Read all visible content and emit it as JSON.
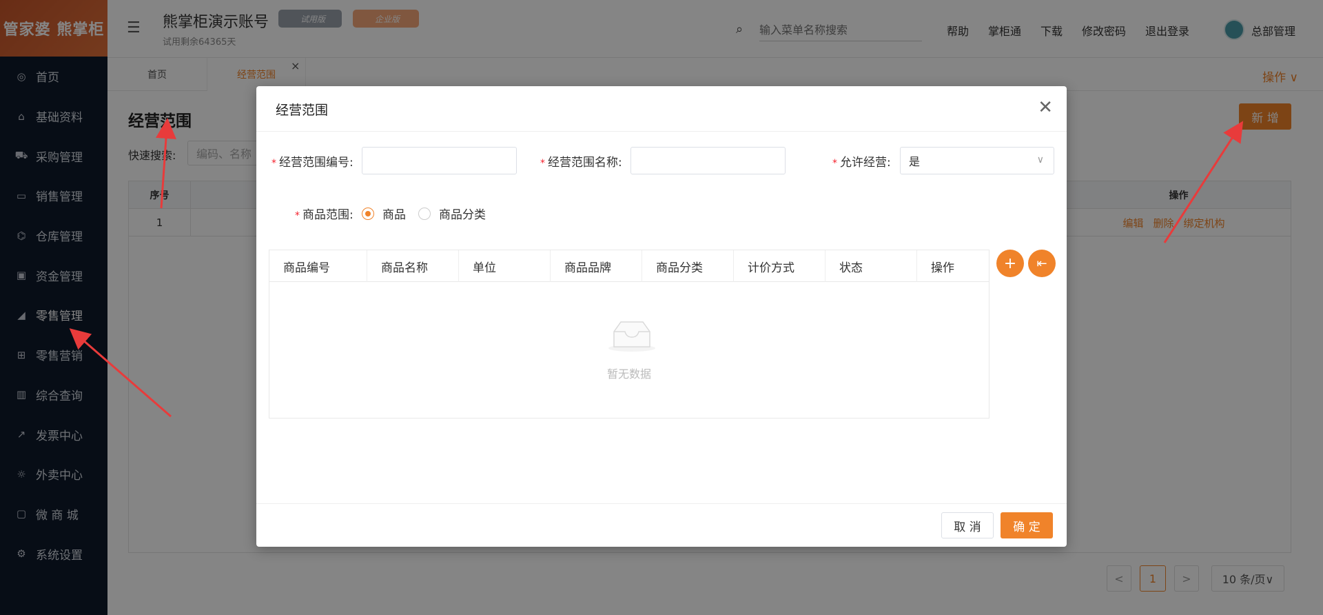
{
  "logo": "管家婆 熊掌柜",
  "sidebar": {
    "items": [
      {
        "label": "首页",
        "icon": "globe-icon"
      },
      {
        "label": "基础资料",
        "icon": "home-icon"
      },
      {
        "label": "采购管理",
        "icon": "cart-icon"
      },
      {
        "label": "销售管理",
        "icon": "keyboard-icon"
      },
      {
        "label": "仓库管理",
        "icon": "bank-icon"
      },
      {
        "label": "资金管理",
        "icon": "calendar-icon"
      },
      {
        "label": "零售管理",
        "icon": "area-chart-icon"
      },
      {
        "label": "零售营销",
        "icon": "gift-icon"
      },
      {
        "label": "综合查询",
        "icon": "bar-chart-icon"
      },
      {
        "label": "发票中心",
        "icon": "line-chart-icon"
      },
      {
        "label": "外卖中心",
        "icon": "alarm-icon"
      },
      {
        "label": "微 商 城",
        "icon": "bag-icon"
      },
      {
        "label": "系统设置",
        "icon": "gear-icon"
      }
    ]
  },
  "header": {
    "account_title": "熊掌柜演示账号",
    "account_sub": "试用剩余64365天",
    "badge_trial": "试用版",
    "badge_enterprise": "企业版",
    "search_placeholder": "输入菜单名称搜索",
    "links": [
      "帮助",
      "掌柜通",
      "下载",
      "修改密码",
      "退出登录"
    ],
    "user": "总部管理"
  },
  "tabs": {
    "items": [
      "首页",
      "经营范围"
    ],
    "close": "×",
    "ops": "操作 ∨"
  },
  "page": {
    "title": "经营范围",
    "quick_label": "快速搜索:",
    "quick_placeholder": "编码、名称",
    "new_button": "新 增",
    "table_headers": {
      "index": "序号",
      "ops": "操作"
    },
    "rows": [
      {
        "index": "1",
        "actions": [
          "编辑",
          "删除",
          "绑定机构"
        ]
      }
    ],
    "pager": {
      "prev": "<",
      "current": "1",
      "next": ">",
      "size": "10 条/页∨"
    }
  },
  "modal": {
    "title": "经营范围",
    "fields": {
      "code_label": "经营范围编号:",
      "name_label": "经营范围名称:",
      "allow_label": "允许经营:",
      "allow_value": "是",
      "scope_label": "商品范围:"
    },
    "radio": {
      "opt1": "商品",
      "opt2": "商品分类",
      "selected": "商品"
    },
    "grid_headers": [
      "商品编号",
      "商品名称",
      "单位",
      "商品品牌",
      "商品分类",
      "计价方式",
      "状态",
      "操作"
    ],
    "empty_text": "暂无数据",
    "cancel": "取 消",
    "ok": "确 定"
  },
  "colors": {
    "accent": "#f0832a",
    "sidebar": "#0f1a2b",
    "annotation": "#e83b3b"
  }
}
